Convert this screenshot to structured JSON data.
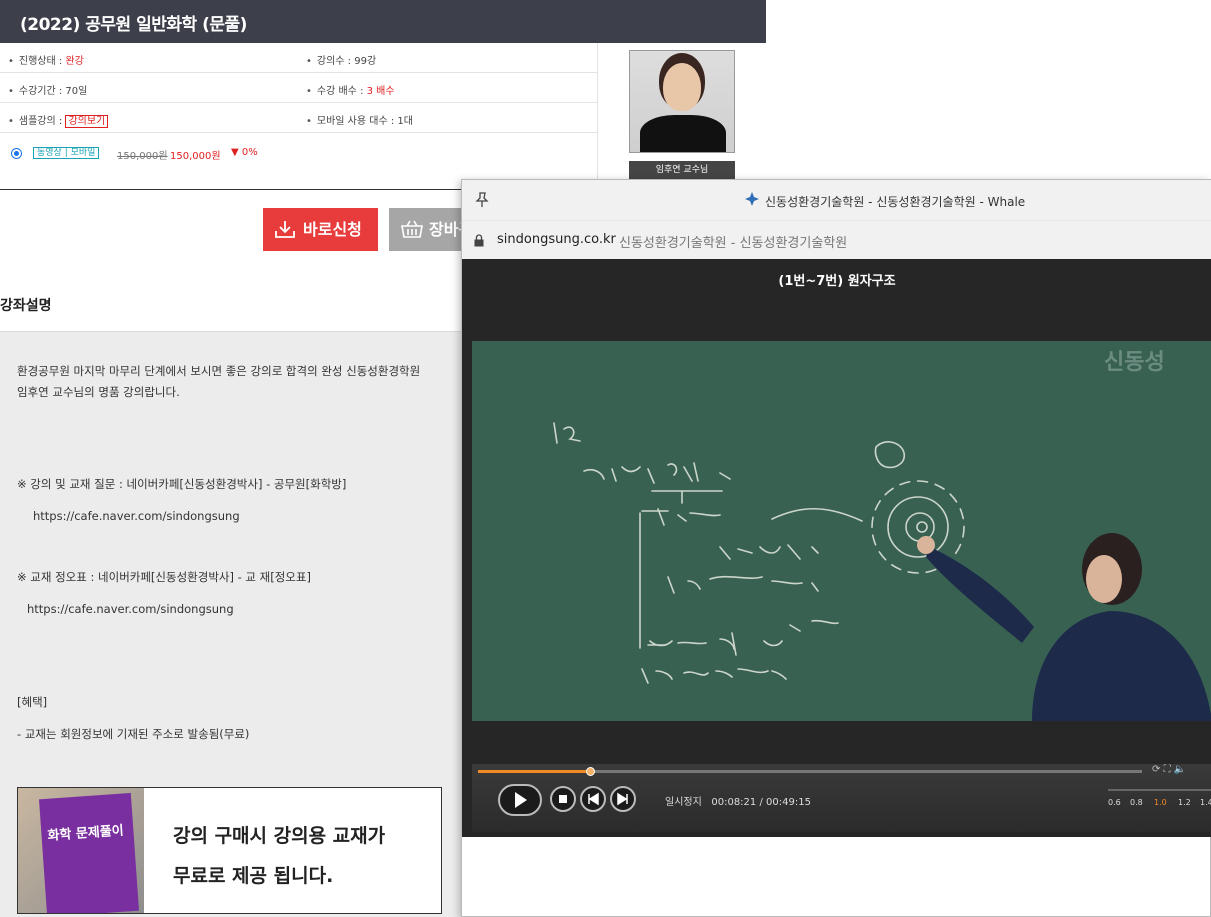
{
  "course": {
    "title": "(2022) 공무원 일반화학 (문풀)",
    "status_label": "진행상태 : ",
    "status_value": "완강",
    "lectures": "강의수 : 99강",
    "period": "수강기간 : 70일",
    "multiplier_label": "수강 배수 : ",
    "multiplier_value": "3 배수",
    "sample_label": "샘플강의 : ",
    "sample_button": "강의보기",
    "mobile_devices": "모바일 사용 대수 : 1대",
    "option_tag": "동영상 | 모바일",
    "price_original": "150,000원",
    "price_sale": "150,000원",
    "discount": "0%"
  },
  "professor": {
    "name": "임후연 교수님"
  },
  "actions": {
    "apply": "바로신청",
    "cart": "장바구니"
  },
  "description": {
    "heading": "강좌설명",
    "line1": "환경공무원 마지막 마무리 단계에서 보시면 좋은 강의로 합격의 완성 신동성환경학원",
    "line2": "임후연 교수님의 명품 강의랍니다.",
    "qa": "※ 강의 및 교재 질문 : 네이버카페[신동성환경박사] - 공무원[화학방]",
    "qa_url": "https://cafe.naver.com/sindongsung",
    "errata": "※ 교재 정오표 : 네이버카페[신동성환경박사] - 교 재[정오표]",
    "errata_url": "https://cafe.naver.com/sindongsung",
    "benefit_heading": "[혜택]",
    "benefit": "- 교재는 회원정보에 기재된 주소로 발송됨(무료)",
    "banner_line1": "강의 구매시 강의용 교재가",
    "banner_line2": "무료로 제공 됩니다.",
    "book_title": "화학 문제풀이"
  },
  "popup": {
    "window_title": "신동성환경기술학원 - 신동성환경기술학원 - Whale",
    "domain": "sindongsung.co.kr",
    "page_title": "신동성환경기술학원 - 신동성환경기술학원",
    "lesson_title": "(1번~7번) 원자구조",
    "player_status": "일시정지",
    "time_current": "00:08:21",
    "time_total": "00:49:15",
    "progress_fraction": 0.17,
    "speeds": [
      "0.6",
      "0.8",
      "1.0",
      "1.2",
      "1.4"
    ],
    "selected_speed": "1.0",
    "watermark": "신동성"
  },
  "colors": {
    "accent_red": "#e83c3c",
    "title_bar": "#3d3f4a",
    "progress": "#f08a24"
  }
}
